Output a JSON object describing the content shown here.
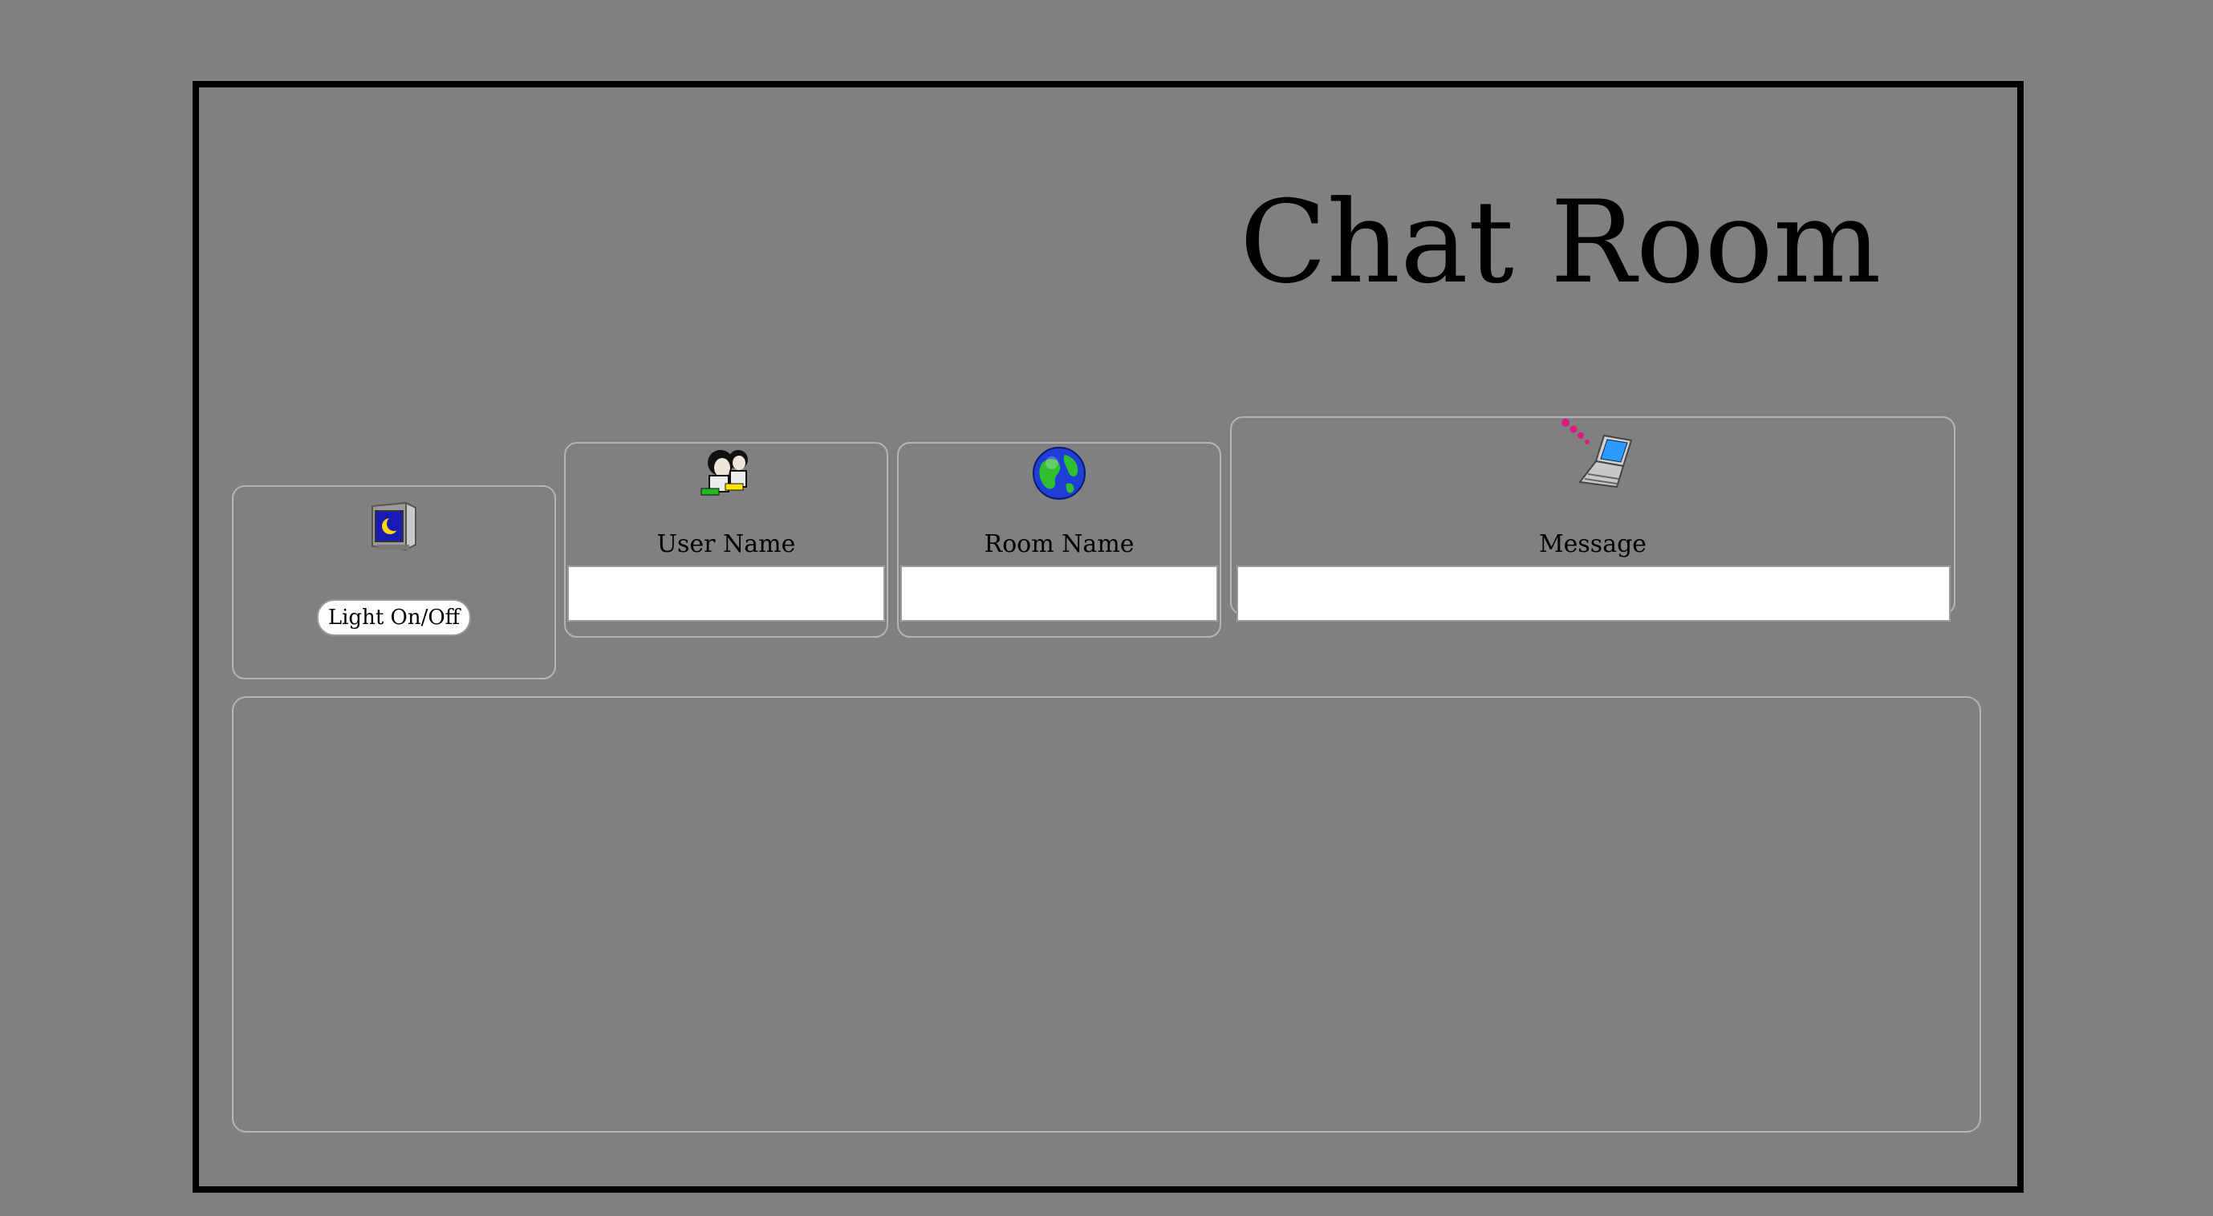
{
  "page": {
    "title": "Chat Room",
    "background_color": "#808080"
  },
  "light_panel": {
    "icon": "monitor-moon-icon",
    "button_label": "Light On/Off"
  },
  "user_panel": {
    "icon": "users-icon",
    "label": "User Name",
    "value": ""
  },
  "room_panel": {
    "icon": "globe-icon",
    "label": "Room Name",
    "value": ""
  },
  "message_panel": {
    "icon": "laptop-signal-icon",
    "label": "Message",
    "value": ""
  },
  "messages": []
}
